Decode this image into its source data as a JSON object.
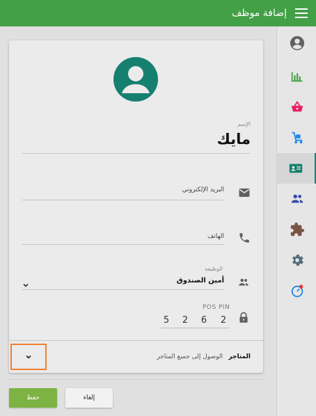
{
  "header": {
    "title": "إضافة موظف"
  },
  "colors": {
    "toolbar": "#43a047",
    "accent": "#16806f",
    "save": "#7cb342",
    "focus_outline": "#f08030"
  },
  "nav": {
    "items": [
      {
        "icon": "account-circle-icon"
      },
      {
        "icon": "bar-chart-icon"
      },
      {
        "icon": "shopping-basket-icon"
      },
      {
        "icon": "hand-truck-icon"
      },
      {
        "icon": "id-card-icon",
        "active": true
      },
      {
        "icon": "people-icon"
      },
      {
        "icon": "puzzle-icon"
      },
      {
        "icon": "settings-gear-icon"
      },
      {
        "icon": "help-icon"
      }
    ]
  },
  "form": {
    "name": {
      "label": "الإسم",
      "value": "مايك"
    },
    "email": {
      "placeholder": "البريد الإلكتروني"
    },
    "phone": {
      "placeholder": "الهاتف"
    },
    "role": {
      "label": "الوظيفة",
      "value": "أمين الصندوق"
    },
    "pin": {
      "label": "POS PIN",
      "digits": [
        "5",
        "2",
        "6",
        "2"
      ]
    },
    "stores": {
      "label": "المتاجر",
      "value": "الوصول إلى جميع المتاجر"
    }
  },
  "actions": {
    "save_label": "حفظ",
    "cancel_label": "إلغاء"
  }
}
